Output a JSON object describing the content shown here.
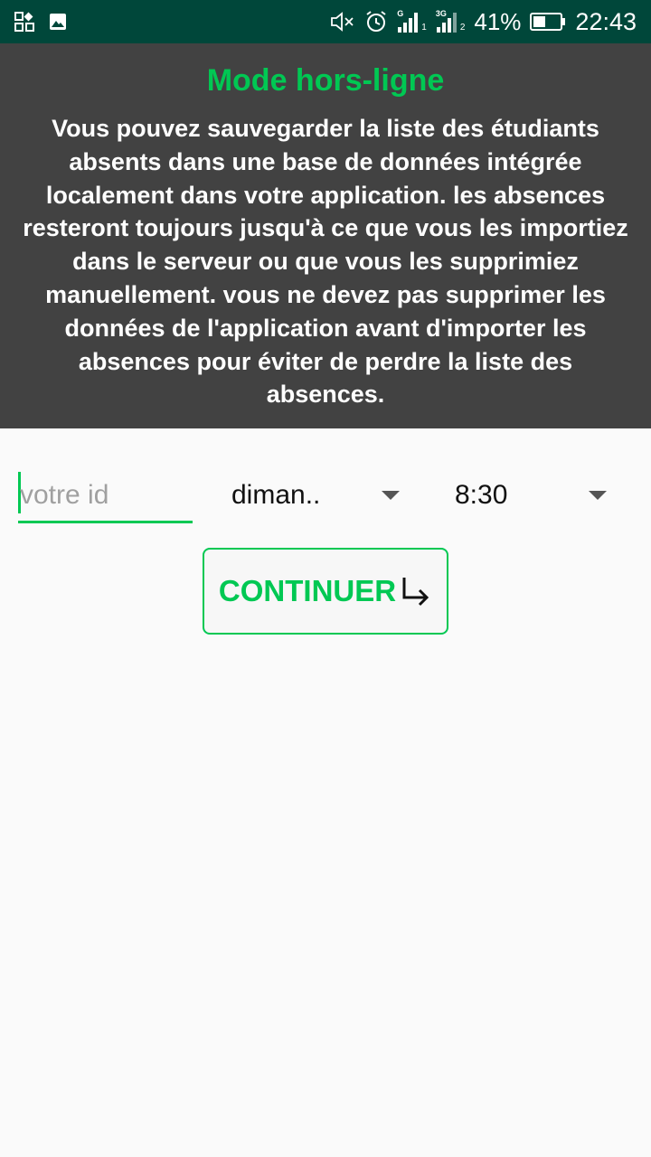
{
  "status_bar": {
    "battery_percent": "41%",
    "time": "22:43",
    "sim1_tag": "G",
    "sim1_num": "1",
    "sim2_tag": "3G",
    "sim2_num": "2",
    "icons": [
      "app-grid-icon",
      "image-icon",
      "mute-icon",
      "alarm-icon",
      "signal-icon",
      "signal-icon",
      "battery-icon"
    ]
  },
  "header": {
    "title": "Mode hors-ligne",
    "description": "Vous pouvez sauvegarder la liste des étudiants absents dans une base de données intégrée localement dans votre application. les absences resteront toujours jusqu'à ce que vous les importiez dans le serveur ou que vous les supprimiez manuellement. vous ne devez pas supprimer les données de l'application avant d'importer les absences pour éviter de perdre la liste des absences."
  },
  "form": {
    "id_placeholder": "votre id",
    "id_value": "",
    "day_selected": "diman..",
    "time_selected": "8:30"
  },
  "continue_button": {
    "label": "CONTINUER",
    "icon": "arrow-down-right-icon"
  },
  "colors": {
    "accent": "#00c853",
    "status_bar": "#00473a",
    "header_bg": "#424242",
    "page_bg": "#fafafa"
  }
}
